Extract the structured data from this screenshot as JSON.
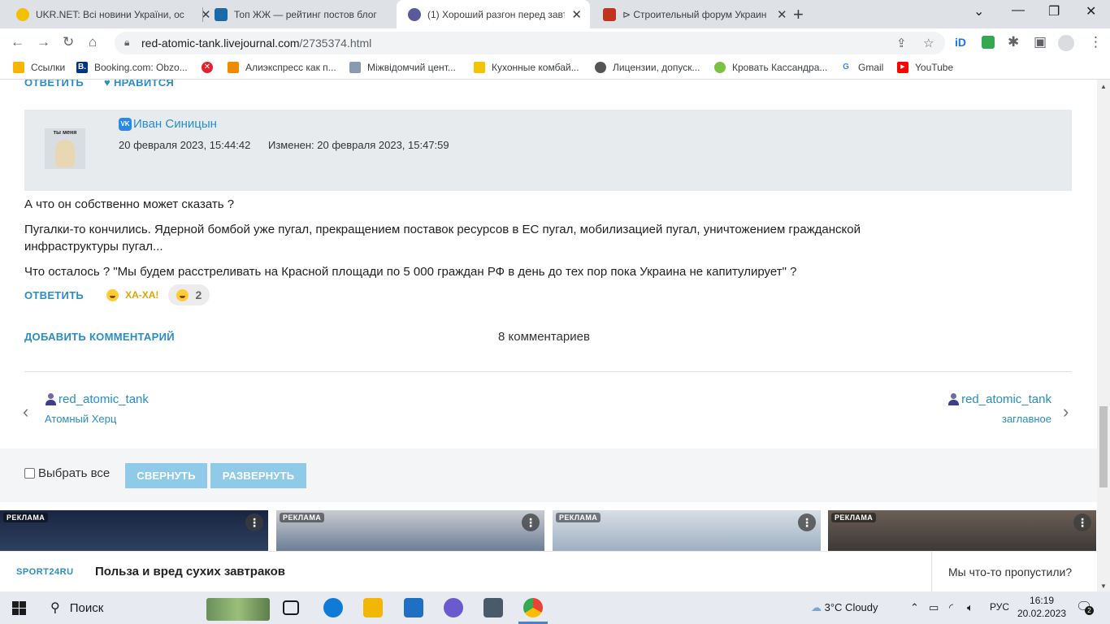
{
  "browser": {
    "tabs": [
      {
        "title": "UKR.NET: Всі новини України, ос",
        "favicon_color": "#f2c200"
      },
      {
        "title": "Топ ЖЖ — рейтинг постов блог",
        "favicon_color": "#1a6aa8"
      },
      {
        "title": "(1) Хороший разгон перед завтр",
        "favicon_color": "#5a5a9a"
      },
      {
        "title": "⊳ Строительный форум Украин",
        "favicon_color": "#c2331f"
      }
    ],
    "url_host": "red-atomic-tank.livejournal.com",
    "url_path": "/2735374.html",
    "bookmarks": [
      {
        "label": "Ссылки",
        "icon_color": "#f5b400"
      },
      {
        "label": "Booking.com: Obzo...",
        "icon_color": "#003580",
        "glyph": "B."
      },
      {
        "label": "",
        "icon_color": "#e5202e",
        "glyph": "✕"
      },
      {
        "label": "Алиэкспресс как п...",
        "icon_color": "#f08a00"
      },
      {
        "label": "Міжвідомчий цент...",
        "icon_color": "#8a9ab0"
      },
      {
        "label": "Кухонные комбай...",
        "icon_color": "#f3c400"
      },
      {
        "label": "Лицензии, допуск...",
        "icon_color": "#555555"
      },
      {
        "label": "Кровать Кассандра...",
        "icon_color": "#7bc142"
      },
      {
        "label": "Gmail",
        "icon_color": "#ffffff",
        "glyph": "G"
      },
      {
        "label": "YouTube",
        "icon_color": "#ff0000",
        "glyph": "▶"
      }
    ]
  },
  "page": {
    "top_reply": "ОТВЕТИТЬ",
    "top_like": "НРАВИТСЯ",
    "comment": {
      "avatar_caption": "ты меня",
      "author": "Иван Синицын",
      "vk_badge": "VK",
      "posted": "20 февраля 2023, 15:44:42",
      "edited_label": "Изменен:",
      "edited": "20 февраля 2023, 15:47:59",
      "paragraphs": [
        "А что он собственно может сказать ?",
        "Пугалки-то кончились. Ядерной бомбой уже пугал, прекращением поставок ресурсов в ЕС пугал, мобилизацией пугал, уничтожением гражданской инфраструктуры пугал...",
        "Что осталось ? \"Мы будем расстреливать на Красной площади по 5 000 граждан РФ в день до тех пор пока Украина не капитулирует\" ?"
      ],
      "reply_label": "ОТВЕТИТЬ",
      "reaction_label": "ХА-ХА!",
      "reaction_count": "2"
    },
    "add_comment": "ДОБАВИТЬ КОММЕНТАРИЙ",
    "comment_count": "8 комментариев",
    "prev_post": {
      "author": "red_atomic_tank",
      "title": "Атомный Херц"
    },
    "next_post": {
      "author": "red_atomic_tank",
      "title": "заглавное"
    },
    "select_all": "Выбрать все",
    "collapse_btn": "СВЕРНУТЬ",
    "expand_btn": "РАЗВЕРНУТЬ",
    "ad_label": "РЕКЛАМА",
    "footer": {
      "source": "SPORT24RU",
      "headline": "Польза и вред сухих завтраков",
      "missed": "Мы что-то пропустили?"
    }
  },
  "taskbar": {
    "search": "Поиск",
    "weather": "3°C  Cloudy",
    "lang": "РУС",
    "time": "16:19",
    "date": "20.02.2023",
    "notifications": "2"
  }
}
